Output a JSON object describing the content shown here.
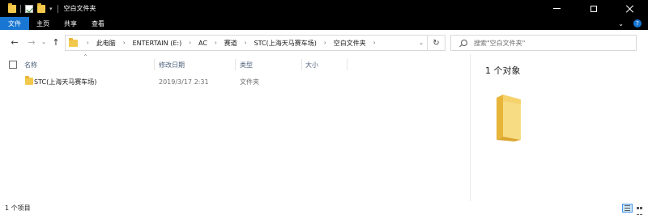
{
  "window": {
    "title": "空白文件夹",
    "quick_access": {
      "dropdown_glyph": "▾"
    },
    "controls": {
      "minimize": "minimize",
      "maximize": "maximize",
      "close": "close"
    }
  },
  "ribbon": {
    "tabs": [
      "文件",
      "主页",
      "共享",
      "查看"
    ],
    "expand_glyph": "⌄",
    "help_glyph": "?"
  },
  "nav": {
    "back_glyph": "←",
    "forward_glyph": "→",
    "recent_glyph": "⌄",
    "up_glyph": "↑",
    "breadcrumb": [
      "此电脑",
      "ENTERTAIN (E:)",
      "AC",
      "赛道",
      "STC(上海天马赛车场)",
      "空白文件夹"
    ],
    "breadcrumb_separator": "›",
    "dropdown_glyph": "⌄",
    "refresh_glyph": "↻"
  },
  "search": {
    "placeholder": "搜索\"空白文件夹\""
  },
  "columns": {
    "name": "名称",
    "date": "修改日期",
    "type": "类型",
    "size": "大小",
    "sort_glyph": "^"
  },
  "rows": [
    {
      "name": "STC(上海天马赛车场)",
      "date": "2019/3/17 2:31",
      "type": "文件夹",
      "size": ""
    }
  ],
  "details": {
    "title": "1 个对象"
  },
  "status": {
    "text": "1 个项目"
  },
  "colors": {
    "titlebar_bg": "#000000",
    "file_tab_bg": "#1976d2",
    "folder_yellow": "#f2c94c",
    "header_text": "#4c607a",
    "secondary_text": "#6d6d6d"
  }
}
